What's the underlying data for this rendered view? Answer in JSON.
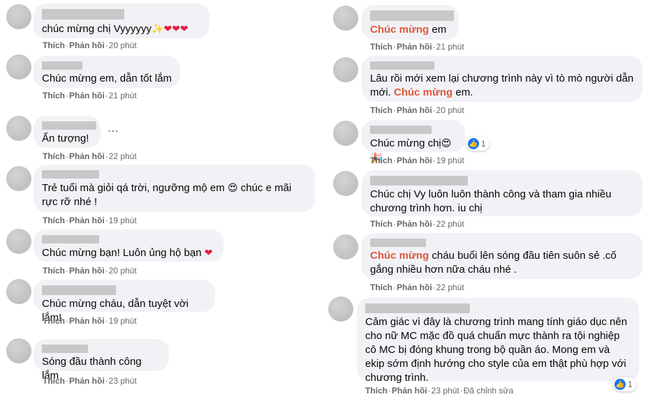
{
  "actions": {
    "like": "Thích",
    "reply": "Phản hồi",
    "edited": "Đã chỉnh sửa",
    "dot": "·"
  },
  "left_comments": [
    {
      "text": "chúc mừng chị Vyyyyyy",
      "emoji": "✨❤❤❤",
      "time": "20 phút"
    },
    {
      "text": "Chúc mừng em, dẫn tốt lắm",
      "time": "21 phút"
    },
    {
      "text": "Ấn tượng!",
      "time": "22 phút"
    },
    {
      "text_line1": "Trẻ tuổi mà giỏi qá trời, ngưỡng mộ em",
      "emoji": "😍",
      "text_line1b": "chúc e mãi",
      "text_line2": "rực rỡ nhé !",
      "time": "19 phút"
    },
    {
      "text": "Chúc mừng bạn! Luôn ủng hộ bạn",
      "emoji": "❤",
      "time": "20 phút"
    },
    {
      "text": "Chúc mừng cháu, dẫn tuyệt vời lắm!",
      "time": "19 phút"
    },
    {
      "text": "Sóng đầu thành công lắm",
      "time": "23 phút"
    }
  ],
  "right_comments": [
    {
      "highlight": "Chúc mừng",
      "text": " em",
      "time": "21 phút"
    },
    {
      "line1": "Lâu rồi mới xem lại chương trình này vì tò mò người dẫn",
      "line2_pre": "mới. ",
      "highlight": "Chúc mừng",
      "line2_post": " em.",
      "time": "20 phút"
    },
    {
      "text": "Chúc mừng chị",
      "emoji": "😍🎉",
      "reaction_count": "1",
      "time": "19 phút"
    },
    {
      "line1": "Chúc chị Vy luôn luôn thành công và tham gia nhiều",
      "line2": "chương trình hơn. iu chị",
      "time": "22 phút"
    },
    {
      "highlight": "Chúc mừng",
      "line1_post": " cháu buổi lên sóng đầu tiên suôn sẻ .cố",
      "line2": "gắng nhiều hơn nữa cháu nhé .",
      "time": "22 phút"
    },
    {
      "lines": [
        "Cảm giác vì đây là chương trình mang tính giáo dục nên",
        "cho nữ MC mặc đồ quá chuẩn mực thành ra tội nghiệp",
        "cô MC bị đóng khung trong bộ quần áo. Mong em và",
        "ekip sớm định hướng cho style của em thật phù hợp với",
        "chương trình."
      ],
      "reaction_count": "1",
      "time": "23 phút"
    }
  ],
  "more_options_icon": "⋯"
}
